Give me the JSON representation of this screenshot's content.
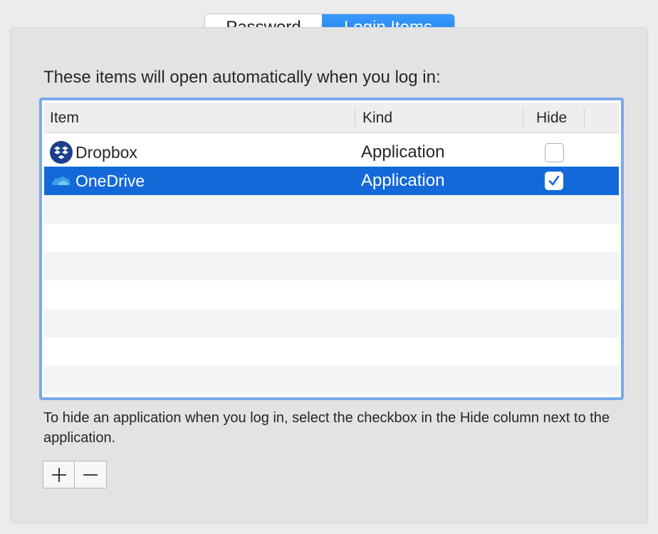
{
  "tabs": [
    {
      "label": "Password",
      "selected": false
    },
    {
      "label": "Login Items",
      "selected": true
    }
  ],
  "intro_text": "These items will open automatically when you log in:",
  "table": {
    "columns": [
      "Item",
      "Kind",
      "Hide"
    ],
    "rows": [
      {
        "name": "Dropbox",
        "kind": "Application",
        "hide": false,
        "icon": "dropbox-icon",
        "selected": false
      },
      {
        "name": "OneDrive",
        "kind": "Application",
        "hide": true,
        "icon": "onedrive-icon",
        "selected": true
      }
    ]
  },
  "footnote": "To hide an application when you log in, select the checkbox in the Hide column next to the application.",
  "buttons": {
    "add": "add-icon",
    "remove": "remove-icon"
  },
  "colors": {
    "accent": "#1a7ef1",
    "selection": "#1469d8",
    "focus_ring": "#7aa9ea",
    "dropbox_badge": "#1b3f8b",
    "onedrive": "#3aa0e8"
  }
}
